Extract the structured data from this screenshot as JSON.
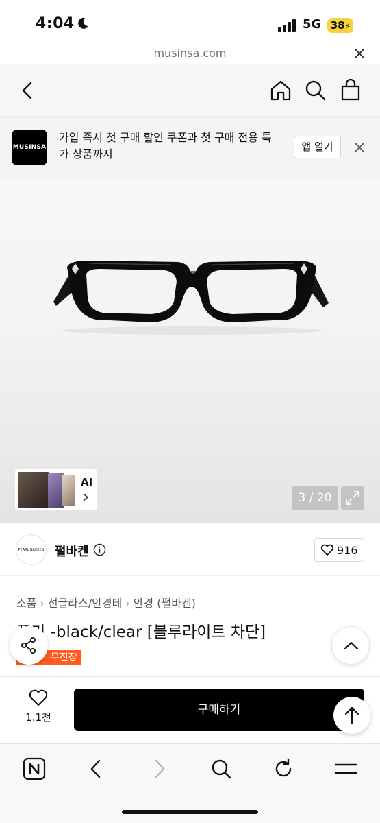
{
  "status": {
    "time": "4:04",
    "network": "5G",
    "battery": "38"
  },
  "browser": {
    "url": "musinsa.com"
  },
  "banner": {
    "logo_text": "MUSINSA",
    "message": "가입 즉시 첫 구매 할인 쿠폰과 첫 구매 전용 특가 상품까지",
    "open_label": "앱 열기"
  },
  "gallery": {
    "counter": "3 / 20",
    "ai_label": "AI"
  },
  "brand": {
    "logo_text": "PEARL BACKEN",
    "name": "펄바켄",
    "like_count": "916"
  },
  "breadcrumb": [
    "소품",
    "선글라스/안경테",
    "안경 (펄바켄)"
  ],
  "product": {
    "title": "푸키 -black/clear [블루라이트 차단]",
    "tag": "무진장"
  },
  "buybar": {
    "wish_count": "1.1천",
    "buy_label": "구매하기"
  },
  "icons": {
    "back": "chevron-left-icon",
    "home": "home-icon",
    "search": "search-icon",
    "bag": "shopping-bag-icon",
    "share": "share-icon",
    "up": "chevron-up-icon",
    "scroll_top": "arrow-up-icon",
    "toolbar": [
      "naver-icon",
      "back-icon",
      "forward-icon",
      "search-icon",
      "reload-icon",
      "menu-icon"
    ]
  }
}
